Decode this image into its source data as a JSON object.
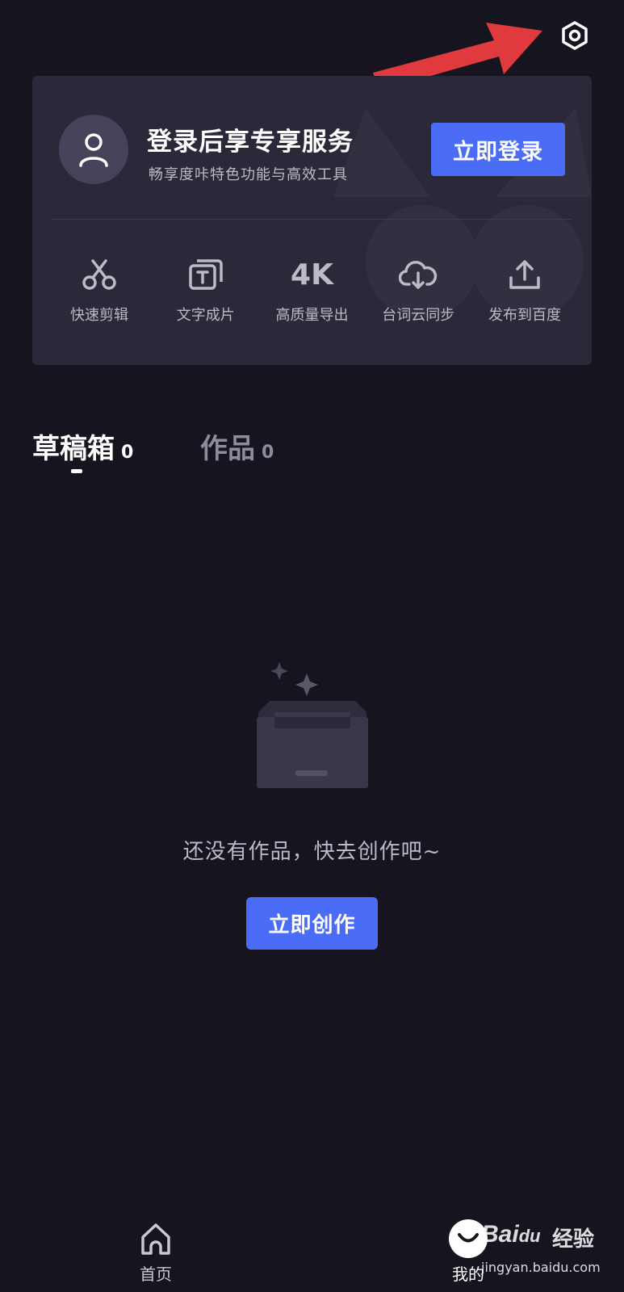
{
  "login_card": {
    "title": "登录后享专享服务",
    "subtitle": "畅享度咔特色功能与高效工具",
    "login_button": "立即登录",
    "features": [
      {
        "icon": "scissors-icon",
        "label": "快速剪辑"
      },
      {
        "icon": "text-frame-icon",
        "label": "文字成片"
      },
      {
        "icon": "4k-icon",
        "label": "高质量导出"
      },
      {
        "icon": "cloud-download-icon",
        "label": "台词云同步"
      },
      {
        "icon": "upload-icon",
        "label": "发布到百度"
      }
    ],
    "feature_4k_glyph": "4K"
  },
  "tabs": [
    {
      "label": "草稿箱",
      "count": "0",
      "active": true
    },
    {
      "label": "作品",
      "count": "0",
      "active": false
    }
  ],
  "empty_state": {
    "message": "还没有作品，快去创作吧~",
    "create_button": "立即创作"
  },
  "bottom_nav": {
    "home_label": "首页",
    "mine_label": "我的"
  },
  "watermark": {
    "logo": "Bai",
    "logo_suffix": "du",
    "brand": "经验",
    "url": "jingyan.baidu.com"
  },
  "colors": {
    "background": "#15141f",
    "card": "#2b2939",
    "accent": "#4a6cf7",
    "annotation_arrow": "#e03a3e"
  }
}
